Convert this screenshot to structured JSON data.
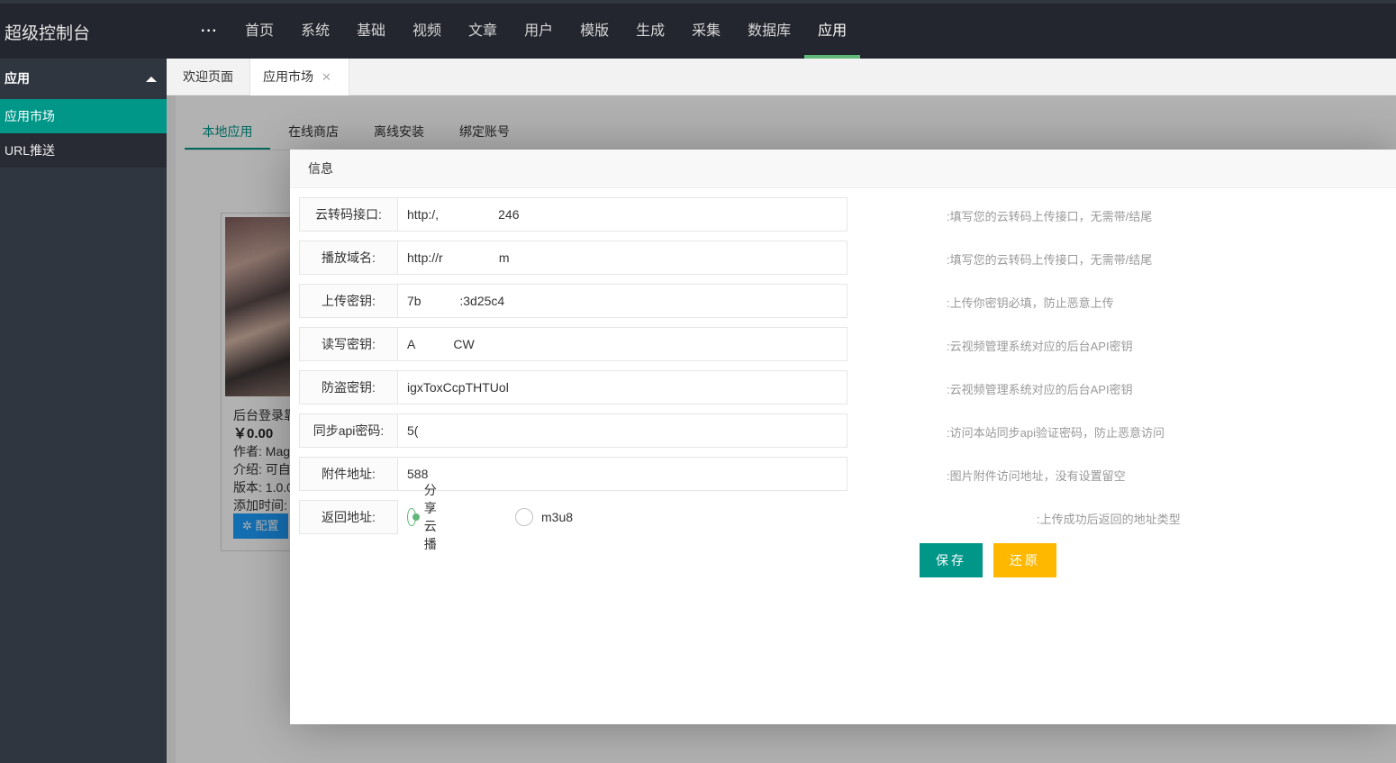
{
  "header": {
    "brand": "超级控制台",
    "nav": [
      {
        "label": "···"
      },
      {
        "label": "首页"
      },
      {
        "label": "系统"
      },
      {
        "label": "基础"
      },
      {
        "label": "视频"
      },
      {
        "label": "文章"
      },
      {
        "label": "用户"
      },
      {
        "label": "模版"
      },
      {
        "label": "生成"
      },
      {
        "label": "采集"
      },
      {
        "label": "数据库"
      },
      {
        "label": "应用"
      }
    ],
    "active_nav": "应用"
  },
  "sidebar": {
    "group_label": "应用",
    "items": [
      {
        "label": "应用市场",
        "active": true
      },
      {
        "label": "URL推送",
        "active": false
      }
    ]
  },
  "tabs": {
    "welcome": "欢迎页面",
    "market": "应用市场",
    "close_glyph": "✕"
  },
  "subtabs": [
    "本地应用",
    "在线商店",
    "离线安装",
    "绑定账号"
  ],
  "card": {
    "title": "后台登录靠",
    "price": "￥0.00",
    "author": "作者: Mag",
    "intro": "介绍: 可自",
    "version": "版本: 1.0.0",
    "added": "添加时间:",
    "config_label": "配置",
    "config_icon": "gear-icon"
  },
  "modal": {
    "title": "信息",
    "fields": [
      {
        "label": "云转码接口:",
        "value": "http:/,                 246",
        "tip": ":填写您的云转码上传接口，无需带/结尾"
      },
      {
        "label": "播放域名:",
        "value": "http://r                m",
        "tip": ":填写您的云转码上传接口，无需带/结尾"
      },
      {
        "label": "上传密钥:",
        "value": "7b           :3d25c4",
        "tip": ":上传你密钥必填，防止恶意上传"
      },
      {
        "label": "读写密钥:",
        "value": "A           CW",
        "tip": ":云视频管理系统对应的后台API密钥"
      },
      {
        "label": "防盗密钥:",
        "value": "igxToxCcpTHTUol",
        "tip": ":云视频管理系统对应的后台API密钥"
      },
      {
        "label": "同步api密码:",
        "value": "5(",
        "tip": ":访问本站同步api验证密码，防止恶意访问"
      },
      {
        "label": "附件地址:",
        "value": "588",
        "tip": ":图片附件访问地址，没有设置留空"
      }
    ],
    "return_field": {
      "label": "返回地址:",
      "options": [
        {
          "label": "分享云播",
          "checked": true
        },
        {
          "label": "m3u8",
          "checked": false
        }
      ],
      "tip": ":上传成功后返回的地址类型"
    },
    "save_label": "保存",
    "reset_label": "还原"
  },
  "colors": {
    "header_bg": "#23262e",
    "sidebar_bg": "#2f3640",
    "accent": "#009688",
    "nav_active_bar": "#5fb878",
    "reset": "#ffb800",
    "config": "#1e9fff"
  }
}
